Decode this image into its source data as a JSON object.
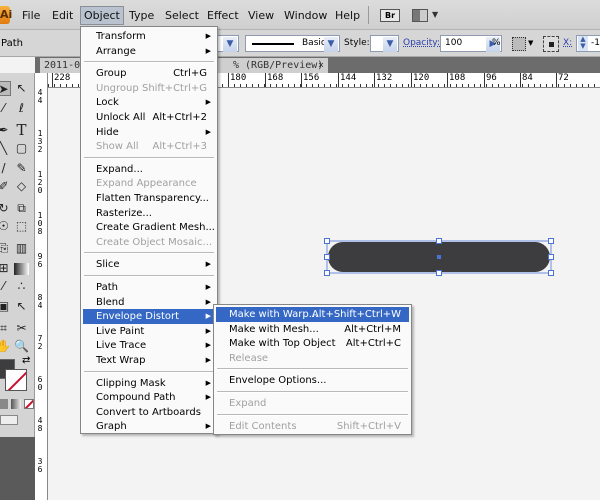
{
  "menubar": {
    "logo": "Ai",
    "items": [
      "File",
      "Edit",
      "Object",
      "Type",
      "Select",
      "Effect",
      "View",
      "Window",
      "Help"
    ],
    "active": "Object",
    "bridge_icon": "Br"
  },
  "control_bar": {
    "selection_label": "Path",
    "stroke_profile": "Basic",
    "style_label": "Style:",
    "opacity_label": "Opacity:",
    "opacity_value": "100",
    "percent": "%",
    "x_label": "X:",
    "x_value": "-1"
  },
  "document_tab": {
    "name_start": "2011-0",
    "name_end": "% (RGB/Preview)",
    "close": "×"
  },
  "rulers": {
    "horizontal": [
      "228",
      "180",
      "168",
      "156",
      "144",
      "132",
      "120",
      "108",
      "96",
      "84",
      "72"
    ],
    "vertical": [
      "44",
      "132",
      "120",
      "108",
      "96",
      "84",
      "72",
      "60",
      "48",
      "36"
    ]
  },
  "object_menu": [
    {
      "label": "Transform",
      "submenu": true
    },
    {
      "label": "Arrange",
      "submenu": true
    },
    {
      "sep": true
    },
    {
      "label": "Group",
      "shortcut": "Ctrl+G"
    },
    {
      "label": "Ungroup",
      "shortcut": "Shift+Ctrl+G",
      "disabled": true
    },
    {
      "label": "Lock",
      "submenu": true
    },
    {
      "label": "Unlock All",
      "shortcut": "Alt+Ctrl+2"
    },
    {
      "label": "Hide",
      "submenu": true
    },
    {
      "label": "Show All",
      "shortcut": "Alt+Ctrl+3",
      "disabled": true
    },
    {
      "sep": true
    },
    {
      "label": "Expand..."
    },
    {
      "label": "Expand Appearance",
      "disabled": true
    },
    {
      "label": "Flatten Transparency..."
    },
    {
      "label": "Rasterize..."
    },
    {
      "label": "Create Gradient Mesh..."
    },
    {
      "label": "Create Object Mosaic...",
      "disabled": true
    },
    {
      "sep": true
    },
    {
      "label": "Slice",
      "submenu": true
    },
    {
      "sep": true
    },
    {
      "label": "Path",
      "submenu": true
    },
    {
      "label": "Blend",
      "submenu": true
    },
    {
      "label": "Envelope Distort",
      "submenu": true,
      "highlighted": true
    },
    {
      "label": "Live Paint",
      "submenu": true
    },
    {
      "label": "Live Trace",
      "submenu": true
    },
    {
      "label": "Text Wrap",
      "submenu": true
    },
    {
      "sep": true
    },
    {
      "label": "Clipping Mask",
      "submenu": true
    },
    {
      "label": "Compound Path",
      "submenu": true
    },
    {
      "label": "Convert to Artboards"
    },
    {
      "label": "Graph",
      "submenu": true
    }
  ],
  "envelope_submenu": [
    {
      "label": "Make with Warp...",
      "shortcut": "Alt+Shift+Ctrl+W",
      "highlighted": true
    },
    {
      "label": "Make with Mesh...",
      "shortcut": "Alt+Ctrl+M"
    },
    {
      "label": "Make with Top Object",
      "shortcut": "Alt+Ctrl+C"
    },
    {
      "label": "Release",
      "disabled": true
    },
    {
      "sep": true
    },
    {
      "label": "Envelope Options..."
    },
    {
      "sep": true
    },
    {
      "label": "Expand",
      "disabled": true
    },
    {
      "sep": true
    },
    {
      "label": "Edit Contents",
      "shortcut": "Shift+Ctrl+V",
      "disabled": true
    }
  ],
  "colors": {
    "highlight": "#3468c4",
    "shape_fill": "#3d3c3f",
    "selection": "#4a72d8",
    "fill_swatch": "#3d3c3f",
    "stroke_none": "#c8102e"
  }
}
